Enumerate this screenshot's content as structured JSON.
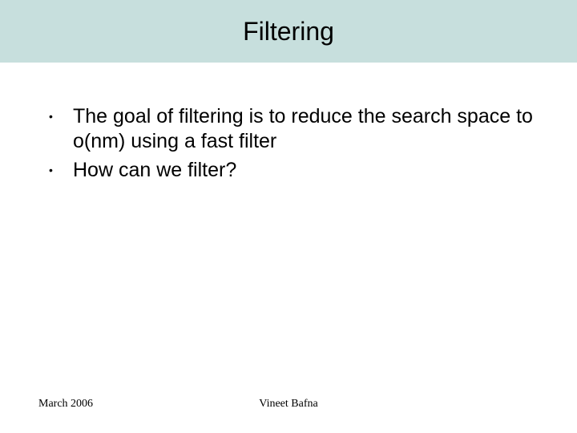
{
  "title": "Filtering",
  "bullets": [
    "The goal of filtering is to reduce the search space to o(nm) using a fast filter",
    "How can we filter?"
  ],
  "footer": {
    "date": "March 2006",
    "author": "Vineet Bafna"
  }
}
